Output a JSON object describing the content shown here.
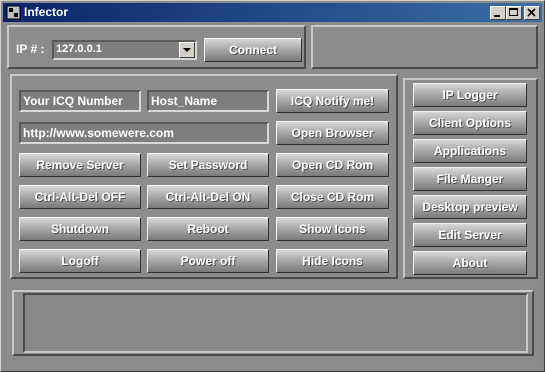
{
  "window": {
    "title": "Infector"
  },
  "connection": {
    "ip_label": "IP # :",
    "ip_value": "127.0.0.1",
    "connect_label": "Connect"
  },
  "fields": {
    "icq_number": "Your ICQ Number",
    "host_name": "Host_Name",
    "url": "http://www.somewere.com"
  },
  "actions": {
    "icq_notify": "ICQ Notify me!",
    "open_browser": "Open Browser",
    "remove_server": "Remove Server",
    "set_password": "Set Password",
    "open_cd": "Open CD Rom",
    "cad_off": "Ctrl-Alt-Del OFF",
    "cad_on": "Ctrl-Alt-Del ON",
    "close_cd": "Close CD Rom",
    "shutdown": "Shutdown",
    "reboot": "Reboot",
    "show_icons": "Show Icons",
    "logoff": "Logoff",
    "power_off": "Power off",
    "hide_icons": "Hide Icons"
  },
  "side_menu": [
    "IP Logger",
    "Client Options",
    "Applications",
    "File Manger",
    "Desktop preview",
    "Edit Server",
    "About"
  ],
  "colors": {
    "titlebar": "#0a246a",
    "face": "#8c8c8c"
  }
}
